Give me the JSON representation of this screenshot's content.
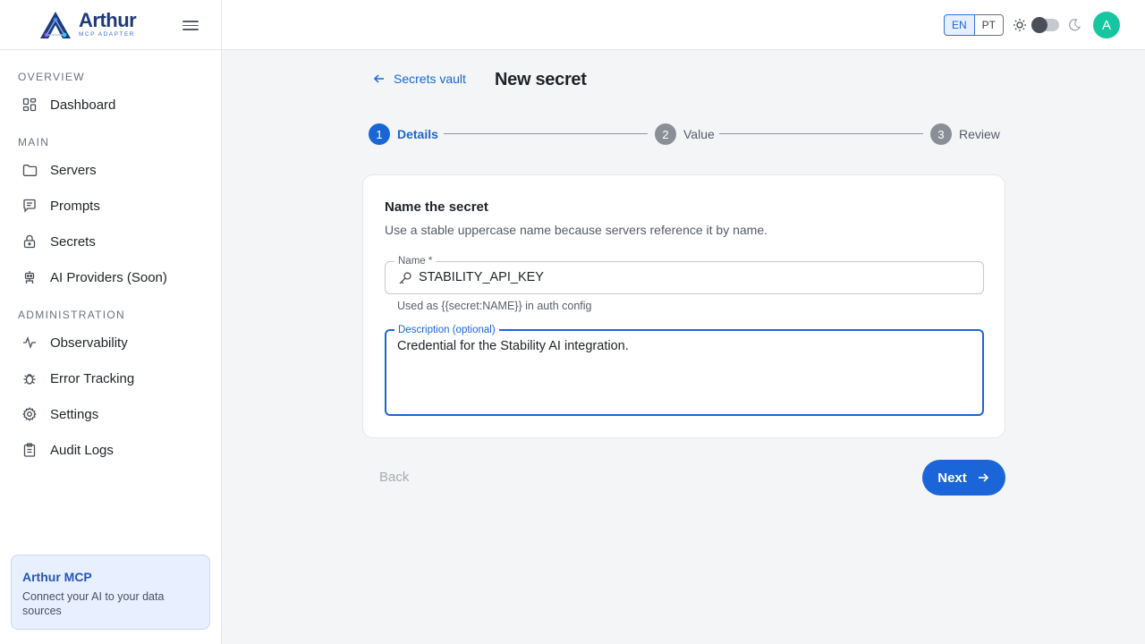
{
  "brand": {
    "name": "Arthur",
    "subtitle": "MCP ADAPTER"
  },
  "sidebar": {
    "sections": [
      {
        "title": "OVERVIEW"
      },
      {
        "title": "MAIN"
      },
      {
        "title": "ADMINISTRATION"
      }
    ],
    "items": [
      {
        "label": "Dashboard",
        "icon": "dashboard-icon"
      },
      {
        "label": "Servers",
        "icon": "folder-icon"
      },
      {
        "label": "Prompts",
        "icon": "message-icon"
      },
      {
        "label": "Secrets",
        "icon": "lock-icon"
      },
      {
        "label": "AI Providers (Soon)",
        "icon": "robot-icon"
      },
      {
        "label": "Observability",
        "icon": "pulse-icon"
      },
      {
        "label": "Error Tracking",
        "icon": "bug-icon"
      },
      {
        "label": "Settings",
        "icon": "gear-icon"
      },
      {
        "label": "Audit Logs",
        "icon": "clipboard-icon"
      }
    ],
    "promo": {
      "title": "Arthur MCP",
      "text": "Connect your AI to your data sources"
    }
  },
  "topbar": {
    "languages": [
      "EN",
      "PT"
    ],
    "active_language": "EN",
    "theme": "light",
    "avatar_initial": "A"
  },
  "page": {
    "back_link": "Secrets vault",
    "title": "New secret"
  },
  "stepper": [
    {
      "number": "1",
      "label": "Details",
      "state": "active"
    },
    {
      "number": "2",
      "label": "Value",
      "state": "pending"
    },
    {
      "number": "3",
      "label": "Review",
      "state": "pending"
    }
  ],
  "form": {
    "heading": "Name the secret",
    "subheading": "Use a stable uppercase name because servers reference it by name.",
    "name_label": "Name *",
    "name_value": "STABILITY_API_KEY",
    "name_helper": "Used as {{secret:NAME}} in auth config",
    "description_label": "Description (optional)",
    "description_value": "Credential for the Stability AI integration."
  },
  "actions": {
    "back_label": "Back",
    "next_label": "Next"
  },
  "colors": {
    "accent": "#1a66d9",
    "avatar": "#16c6a0",
    "brand": "#1f3a7a"
  }
}
